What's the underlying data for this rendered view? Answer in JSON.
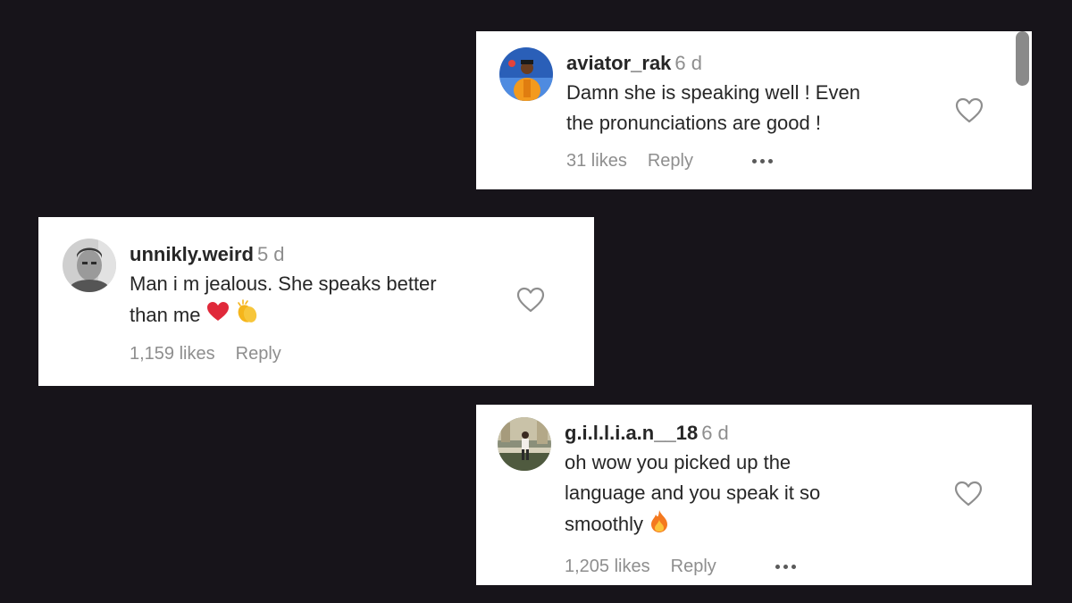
{
  "comments": [
    {
      "username": "aviator_rak",
      "time": "6 d",
      "text_lines": [
        "Damn she is speaking well ! Even",
        "the pronunciations are good !"
      ],
      "likes": "31 likes",
      "reply": "Reply",
      "avatar": "person-in-orange-jacket-avatar",
      "liked": false
    },
    {
      "username": "unnikly.weird",
      "time": "5 d",
      "text_lines": [
        "Man i m jealous. She speaks better",
        "than me"
      ],
      "emojis": [
        "red-heart-emoji",
        "clapping-hands-emoji"
      ],
      "likes": "1,159 likes",
      "reply": "Reply",
      "avatar": "grayscale-portrait-avatar",
      "liked": false
    },
    {
      "username": "g.i.l.l.i.a.n__18",
      "time": "6 d",
      "text_lines": [
        "oh wow you picked up the",
        "language and you speak it so",
        "smoothly"
      ],
      "emojis": [
        "fire-emoji"
      ],
      "likes": "1,205 likes",
      "reply": "Reply",
      "avatar": "person-sitting-outdoors-avatar",
      "liked": false
    }
  ],
  "colors": {
    "background": "#17141a",
    "card": "#ffffff",
    "username": "#262626",
    "secondary_text": "#8e8e8e",
    "heart_emoji": "#e0293a",
    "clap_emoji": "#f5b51b",
    "fire_emoji": "#f4791f"
  }
}
